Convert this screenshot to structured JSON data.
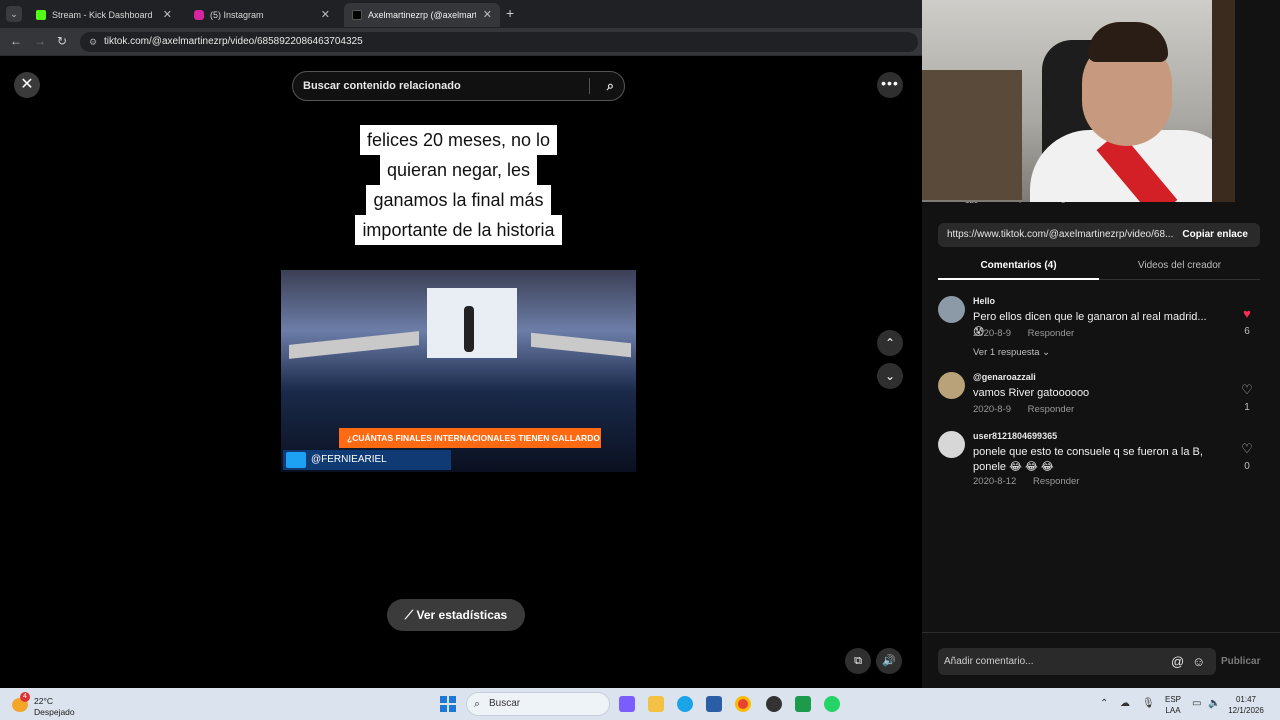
{
  "browser": {
    "tabs": [
      {
        "title": "Stream - Kick Dashboard",
        "favicon_color": "#53fc18"
      },
      {
        "title": "(5) Instagram",
        "favicon_color": "#d6249f"
      },
      {
        "title": "Axelmartinezrp (@axelmarti...",
        "favicon_color": "#000000"
      }
    ],
    "url": "tiktok.com/@axelmartinezrp/video/6858922086463704325"
  },
  "video": {
    "search_placeholder": "Buscar contenido relacionado",
    "caption_lines": [
      "felices 20 meses, no lo",
      "quieran negar, les",
      "ganamos la final más",
      "importante de la historia"
    ],
    "lower_third": "¿CUÁNTAS FINALES INTERNACIONALES TIENEN GALLARDO Y GUILLERMO COMO DT?",
    "twitter_handle": "@FERNIEARIEL",
    "stats_button": "Ver estadísticas"
  },
  "panel": {
    "action_counts": {
      "likes": "129",
      "comments": "4",
      "saves": "5"
    },
    "share_url": "https://www.tiktok.com/@axelmartinezrp/video/68...",
    "copy_link": "Copiar enlace",
    "tabs": {
      "comments": "Comentarios (4)",
      "creator_videos": "Videos del creador"
    },
    "comments": [
      {
        "user": "Hello",
        "text": "Pero ellos dicen que le ganaron al real madrid...😰",
        "date": "2020-8-9",
        "reply": "Responder",
        "likes": "6",
        "liked": true,
        "view_replies": "Ver 1 respuesta"
      },
      {
        "user": "@genaroazzali",
        "text": "vamos River gatoooooo",
        "date": "2020-8-9",
        "reply": "Responder",
        "likes": "1",
        "liked": false
      },
      {
        "user": "user8121804699365",
        "text": "ponele que esto te consuele q se fueron a la B, ponele 😂 😂 😂",
        "date": "2020-8-12",
        "reply": "Responder",
        "likes": "0",
        "liked": false
      }
    ],
    "add_comment_placeholder": "Añadir comentario...",
    "publish": "Publicar"
  },
  "taskbar": {
    "weather_badge": "4",
    "temperature": "22°C",
    "weather_desc": "Despejado",
    "search": "Buscar",
    "lang_top": "ESP",
    "lang_bottom": "LAA",
    "time": "01:47",
    "date": "12/1/2026"
  },
  "colors": {
    "accent_like": "#fe2c55",
    "panel_bg": "#121212",
    "taskbar_bg": "#dbe4ee"
  }
}
